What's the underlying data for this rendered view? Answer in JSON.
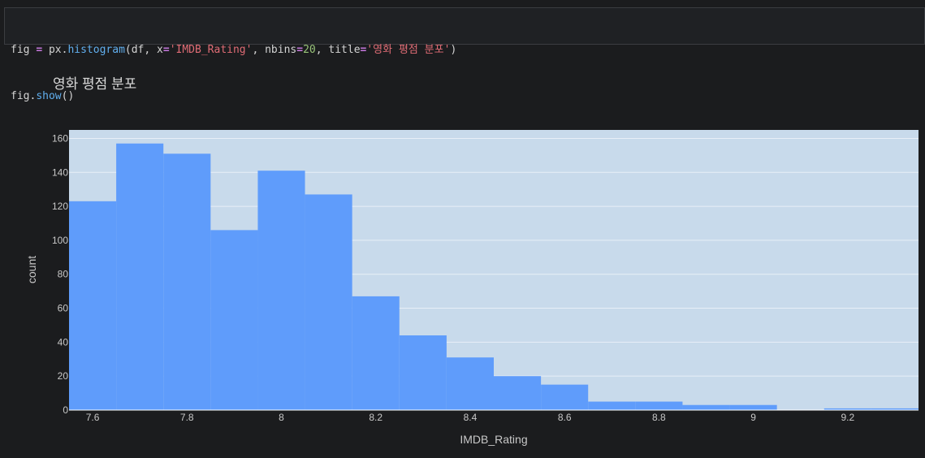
{
  "code": {
    "line1": [
      {
        "t": "fig",
        "c": "tok-name"
      },
      {
        "t": " ",
        "c": "tok-punc"
      },
      {
        "t": "=",
        "c": "tok-op"
      },
      {
        "t": " px.",
        "c": "tok-name"
      },
      {
        "t": "histogram",
        "c": "tok-func"
      },
      {
        "t": "(df, x",
        "c": "tok-punc"
      },
      {
        "t": "=",
        "c": "tok-op"
      },
      {
        "t": "'IMDB_Rating'",
        "c": "tok-str"
      },
      {
        "t": ", nbins",
        "c": "tok-punc"
      },
      {
        "t": "=",
        "c": "tok-op"
      },
      {
        "t": "20",
        "c": "tok-num"
      },
      {
        "t": ", title",
        "c": "tok-punc"
      },
      {
        "t": "=",
        "c": "tok-op"
      },
      {
        "t": "'영화 평점 분포'",
        "c": "tok-str"
      },
      {
        "t": ")",
        "c": "tok-punc"
      }
    ],
    "line2": [
      {
        "t": "fig.",
        "c": "tok-name"
      },
      {
        "t": "show",
        "c": "tok-func"
      },
      {
        "t": "()",
        "c": "tok-punc"
      }
    ]
  },
  "chart_data": {
    "type": "bar",
    "title": "영화 평점 분포",
    "xlabel": "IMDB_Rating",
    "ylabel": "count",
    "bin_edges": [
      7.55,
      7.65,
      7.75,
      7.85,
      7.95,
      8.05,
      8.15,
      8.25,
      8.35,
      8.45,
      8.55,
      8.65,
      8.75,
      8.85,
      8.95,
      9.05,
      9.15,
      9.25,
      9.35
    ],
    "values": [
      123,
      157,
      151,
      106,
      141,
      127,
      67,
      44,
      31,
      20,
      15,
      5,
      5,
      3,
      3,
      0,
      1,
      1
    ],
    "xlim": [
      7.55,
      9.35
    ],
    "ylim": [
      0,
      165
    ],
    "x_ticks": [
      7.6,
      7.8,
      8.0,
      8.2,
      8.4,
      8.6,
      8.8,
      9.0,
      9.2
    ],
    "x_tick_labels": [
      "7.6",
      "7.8",
      "8",
      "8.2",
      "8.4",
      "8.6",
      "8.8",
      "9",
      "9.2"
    ],
    "y_ticks": [
      0,
      20,
      40,
      60,
      80,
      100,
      120,
      140,
      160
    ],
    "y_tick_labels": [
      "0",
      "20",
      "40",
      "60",
      "80",
      "100",
      "120",
      "140",
      "160"
    ],
    "grid": true,
    "colors": {
      "bar": "#5f9cfb",
      "plot_bg": "#c8daeb",
      "grid": "#e8eff7",
      "page_bg": "#1b1c1e"
    }
  }
}
